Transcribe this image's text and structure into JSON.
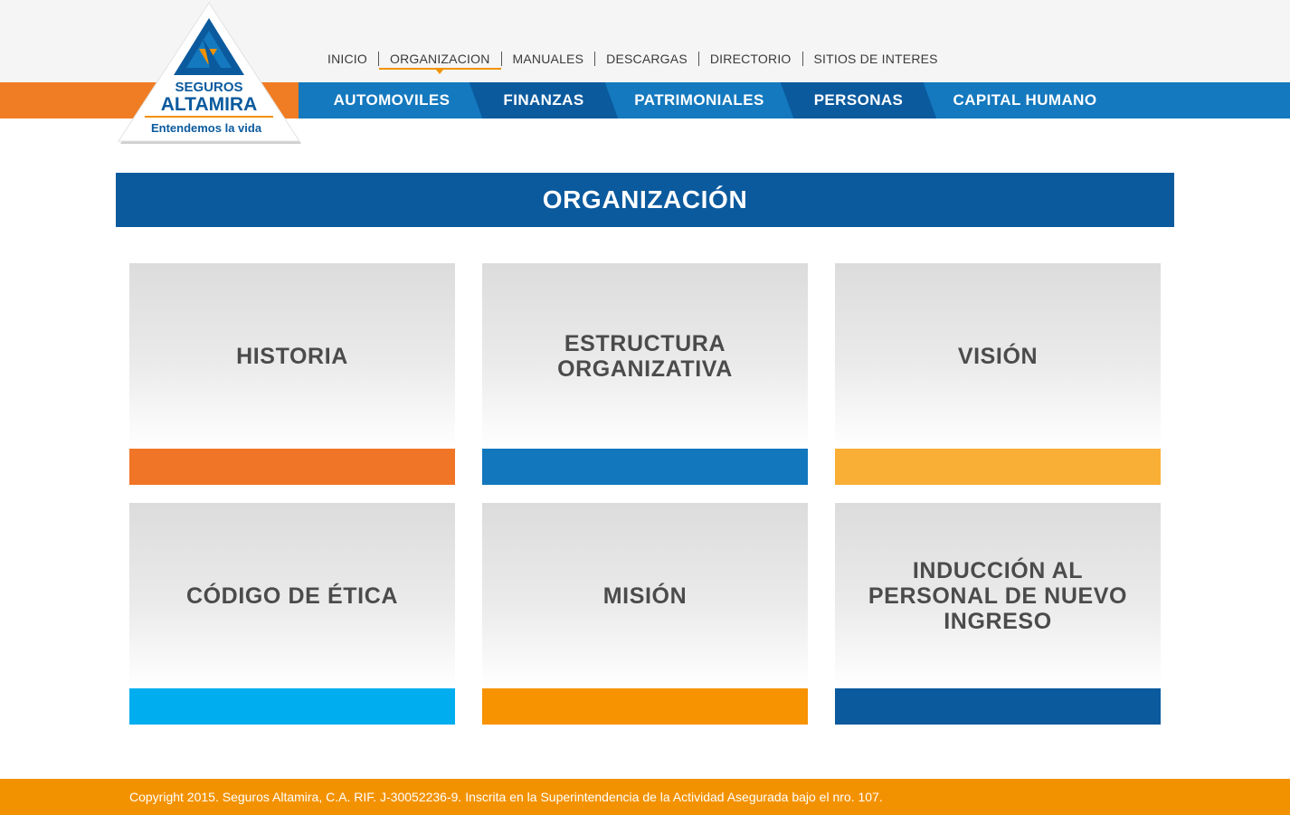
{
  "logo": {
    "brand_top": "SEGUROS",
    "brand_main": "ALTAMIRA",
    "tagline": "Entendemos la vida"
  },
  "top_nav": [
    {
      "label": "INICIO",
      "active": false
    },
    {
      "label": "ORGANIZACION",
      "active": true
    },
    {
      "label": "MANUALES",
      "active": false
    },
    {
      "label": "DESCARGAS",
      "active": false
    },
    {
      "label": "DIRECTORIO",
      "active": false
    },
    {
      "label": "SITIOS DE INTERES",
      "active": false
    }
  ],
  "main_nav": [
    {
      "label": "AUTOMOVILES",
      "color": "#1479bf"
    },
    {
      "label": "FINANZAS",
      "color": "#0b5a9e"
    },
    {
      "label": "PATRIMONIALES",
      "color": "#1479bf"
    },
    {
      "label": "PERSONAS",
      "color": "#0b5a9e"
    },
    {
      "label": "CAPITAL HUMANO",
      "color": "#1479bf"
    }
  ],
  "page_title": "ORGANIZACIÓN",
  "cards": [
    {
      "label": "HISTORIA",
      "bar_color": "#f07526"
    },
    {
      "label": "ESTRUCTURA\nORGANIZATIVA",
      "bar_color": "#1277bd"
    },
    {
      "label": "VISIÓN",
      "bar_color": "#f9ae36"
    },
    {
      "label": "CÓDIGO DE ÉTICA",
      "bar_color": "#00aeef"
    },
    {
      "label": "MISIÓN",
      "bar_color": "#f79200"
    },
    {
      "label": "INDUCCIÓN AL\nPERSONAL DE NUEVO\nINGRESO",
      "bar_color": "#0b5a9e"
    }
  ],
  "footer": {
    "text": "Copyright 2015. Seguros Altamira, C.A. RIF. J-30052236-9. Inscrita en la Superintendencia de la Actividad Asegurada bajo el nro. 107."
  },
  "colors": {
    "brand_blue": "#0b5a9e",
    "nav_blue": "#1479bf",
    "brand_orange": "#f07d23",
    "footer_orange": "#f39200"
  }
}
